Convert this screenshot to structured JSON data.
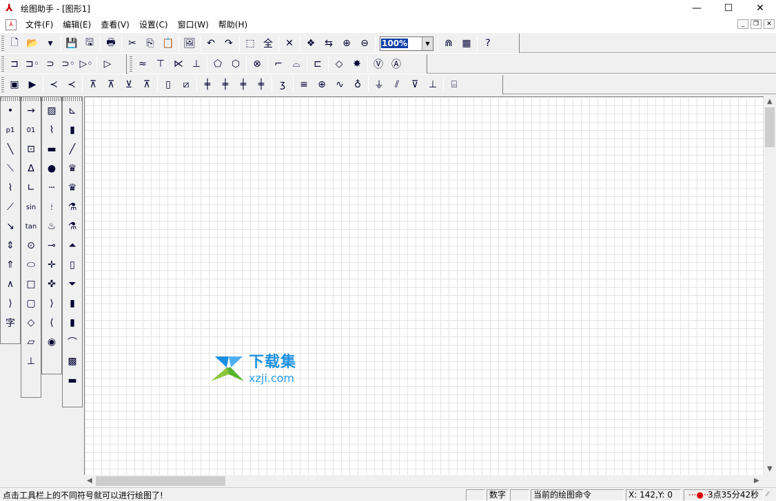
{
  "window": {
    "title": "绘图助手 - [图形1]",
    "minimize": "—",
    "maximize": "☐",
    "close": "✕"
  },
  "menu": [
    "文件(F)",
    "编辑(E)",
    "查看(V)",
    "设置(C)",
    "窗口(W)",
    "帮助(H)"
  ],
  "mdi": {
    "minimize": "_",
    "restore": "❐",
    "close": "✕"
  },
  "toolbar1": {
    "groups": [
      [
        {
          "name": "new-icon",
          "g": "🗋"
        },
        {
          "name": "open-icon",
          "g": "📂"
        },
        {
          "name": "open-dropdown-icon",
          "g": "▾"
        }
      ],
      [
        {
          "name": "save-icon",
          "g": "💾"
        },
        {
          "name": "save-as-icon",
          "g": "🖫"
        }
      ],
      [
        {
          "name": "print-icon",
          "g": "🖶"
        }
      ],
      [
        {
          "name": "cut-icon",
          "g": "✂"
        },
        {
          "name": "copy-icon",
          "g": "⎘"
        },
        {
          "name": "paste-icon",
          "g": "📋"
        }
      ],
      [
        {
          "name": "export-image-icon",
          "g": "🖼"
        }
      ],
      [
        {
          "name": "undo-icon",
          "g": "↶"
        },
        {
          "name": "redo-icon",
          "g": "↷"
        }
      ],
      [
        {
          "name": "select-icon",
          "g": "⬚"
        },
        {
          "name": "select-all-icon",
          "g": "全"
        }
      ],
      [
        {
          "name": "delete-icon",
          "g": "✕"
        }
      ],
      [
        {
          "name": "refresh-icon",
          "g": "❖"
        },
        {
          "name": "swap-icon",
          "g": "⇆"
        },
        {
          "name": "zoom-in-icon",
          "g": "⊕"
        },
        {
          "name": "zoom-out-icon",
          "g": "⊖"
        }
      ]
    ],
    "zoom_value": "100%",
    "after": [
      {
        "name": "magnet-snap-icon",
        "g": "⋒"
      },
      {
        "name": "grid-icon",
        "g": "▦"
      }
    ],
    "help": {
      "name": "help-icon",
      "g": "?"
    }
  },
  "toolbar2": {
    "groupA": [
      {
        "name": "and-gate-icon",
        "g": "⊐"
      },
      {
        "name": "nand-gate-icon",
        "g": "⊐◦"
      },
      {
        "name": "or-gate-icon",
        "g": "⊃"
      },
      {
        "name": "nor-gate-icon",
        "g": "⊃◦"
      },
      {
        "name": "not-gate-icon",
        "g": "▷◦"
      },
      {
        "name": "buffer-icon",
        "g": "▷"
      }
    ],
    "groupB": [
      {
        "name": "wave-icon",
        "g": "≈"
      },
      {
        "name": "connector-icon",
        "g": "⊤"
      },
      {
        "name": "hatch-line-icon",
        "g": "⋉"
      },
      {
        "name": "junction-icon",
        "g": "⊥"
      },
      {
        "name": "pentagon-icon",
        "g": "⬠"
      },
      {
        "name": "hexagon-icon",
        "g": "⬡"
      },
      {
        "name": "lamp-icon",
        "g": "⊗"
      },
      {
        "name": "switch-icon",
        "g": "⌐"
      },
      {
        "name": "push-button-icon",
        "g": "⌓"
      },
      {
        "name": "speaker-icon",
        "g": "⊏"
      },
      {
        "name": "bridge-rectifier-icon",
        "g": "◇"
      },
      {
        "name": "burst-icon",
        "g": "✸"
      },
      {
        "name": "voltmeter-icon",
        "g": "Ⓥ"
      },
      {
        "name": "ammeter-icon",
        "g": "Ⓐ"
      }
    ]
  },
  "toolbar3": [
    {
      "name": "ic-chip-icon",
      "g": "▣"
    },
    {
      "name": "op-amp-icon",
      "g": "▶"
    },
    {
      "name": "npn-transistor-icon",
      "g": "≺"
    },
    {
      "name": "pnp-transistor-icon",
      "g": "≺"
    },
    {
      "name": "diode-icon",
      "g": "⊼"
    },
    {
      "name": "zener-diode-icon",
      "g": "⊼"
    },
    {
      "name": "diode2-icon",
      "g": "⊻"
    },
    {
      "name": "led-icon",
      "g": "⊼"
    },
    {
      "name": "resistor-icon",
      "g": "▯"
    },
    {
      "name": "variable-resistor-icon",
      "g": "⧄"
    },
    {
      "name": "capacitor-icon",
      "g": "╪"
    },
    {
      "name": "polar-capacitor-icon",
      "g": "╪"
    },
    {
      "name": "variable-capacitor-icon",
      "g": "╪"
    },
    {
      "name": "capacitor2-icon",
      "g": "╪"
    },
    {
      "name": "inductor-icon",
      "g": "ʒ"
    },
    {
      "name": "battery-icon",
      "g": "≡"
    },
    {
      "name": "dc-source-icon",
      "g": "⊕"
    },
    {
      "name": "ac-source-icon",
      "g": "∿"
    },
    {
      "name": "terminal-icon",
      "g": "♁"
    },
    {
      "name": "ground-icon",
      "g": "⏚"
    },
    {
      "name": "chassis-ground-icon",
      "g": "⫽"
    },
    {
      "name": "signal-ground-icon",
      "g": "⊽"
    },
    {
      "name": "earth-icon",
      "g": "⊥"
    },
    {
      "name": "fuse-icon",
      "g": "⌸"
    }
  ],
  "palette": {
    "col1": [
      {
        "name": "point-icon",
        "g": "•"
      },
      {
        "name": "labeled-point-icon",
        "g": "p1"
      },
      {
        "name": "line-icon",
        "g": "╲"
      },
      {
        "name": "segment-icon",
        "g": "⟍"
      },
      {
        "name": "polyline-icon",
        "g": "⌇"
      },
      {
        "name": "ray-icon",
        "g": "⟋"
      },
      {
        "name": "vector-icon",
        "g": "↘"
      },
      {
        "name": "double-arrow-icon",
        "g": "⇕"
      },
      {
        "name": "up-arrow-icon",
        "g": "⇑"
      },
      {
        "name": "angle-icon",
        "g": "∧"
      },
      {
        "name": "arc-icon",
        "g": "⟩"
      },
      {
        "name": "text-icon",
        "g": "字"
      }
    ],
    "col2": [
      {
        "name": "arrow-icon",
        "g": "→"
      },
      {
        "name": "number-arrow-icon",
        "g": "01"
      },
      {
        "name": "cart-icon",
        "g": "⊡"
      },
      {
        "name": "function-graph-icon",
        "g": "∆"
      },
      {
        "name": "axes-icon",
        "g": "∟"
      },
      {
        "name": "sin-cos-icon",
        "g": "sin"
      },
      {
        "name": "tan-cot-icon",
        "g": "tan"
      },
      {
        "name": "circle-center-icon",
        "g": "⊙"
      },
      {
        "name": "ellipse-icon",
        "g": "⬭"
      },
      {
        "name": "rectangle-icon",
        "g": "□"
      },
      {
        "name": "rounded-rect-icon",
        "g": "▢"
      },
      {
        "name": "diamond-icon",
        "g": "◇"
      },
      {
        "name": "parallelogram-icon",
        "g": "▱"
      },
      {
        "name": "perpendicular-icon",
        "g": "⊥"
      }
    ],
    "col3": [
      {
        "name": "hatch-surface-icon",
        "g": "▨"
      },
      {
        "name": "spring-icon",
        "g": "⌇"
      },
      {
        "name": "trolley-icon",
        "g": "▬"
      },
      {
        "name": "ball-icon",
        "g": "●"
      },
      {
        "name": "dashed-line-icon",
        "g": "┄"
      },
      {
        "name": "candle-icon",
        "g": "🕯"
      },
      {
        "name": "burner-icon",
        "g": "♨"
      },
      {
        "name": "pin-icon",
        "g": "⊸"
      },
      {
        "name": "cross-arrows-icon",
        "g": "✛"
      },
      {
        "name": "cross-arrows2-icon",
        "g": "✜"
      },
      {
        "name": "lens-convex-icon",
        "g": "⟩"
      },
      {
        "name": "lens-concave-icon",
        "g": "⟨"
      },
      {
        "name": "eye-icon",
        "g": "◉"
      }
    ],
    "col4": [
      {
        "name": "stand-icon",
        "g": "⊾"
      },
      {
        "name": "test-tube-icon",
        "g": "▮"
      },
      {
        "name": "rod-icon",
        "g": "╱"
      },
      {
        "name": "crucible-icon",
        "g": "♛"
      },
      {
        "name": "crucible2-icon",
        "g": "♛"
      },
      {
        "name": "round-flask-icon",
        "g": "⚗"
      },
      {
        "name": "flask2-icon",
        "g": "⚗"
      },
      {
        "name": "conical-flask-icon",
        "g": "⏶"
      },
      {
        "name": "beaker-icon",
        "g": "▯"
      },
      {
        "name": "funnel-icon",
        "g": "⏷"
      },
      {
        "name": "jar-icon",
        "g": "▮"
      },
      {
        "name": "cylinder-icon",
        "g": "▮"
      },
      {
        "name": "bell-jar-icon",
        "g": "⌒"
      },
      {
        "name": "gas-jar-icon",
        "g": "▩"
      },
      {
        "name": "tray-icon",
        "g": "▬"
      }
    ]
  },
  "watermark": {
    "cn": "下载集",
    "url": "xzji.com"
  },
  "status": {
    "hint": "点击工具栏上的不同符号就可以进行绘图了!",
    "box1": "",
    "numlock": "数字",
    "box3": "",
    "command": "当前的绘图命令",
    "coords": "X: 142,Y:   0",
    "time": "3点35分42秒"
  },
  "colors": {
    "selection": "#0a3fa8",
    "watermark": "#1a8fe0",
    "grid": "#e4e4e4"
  }
}
